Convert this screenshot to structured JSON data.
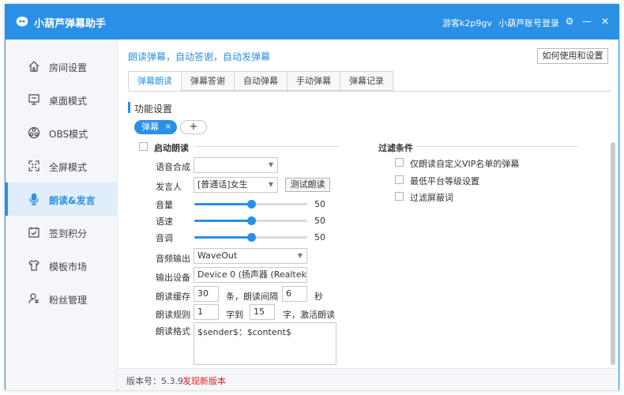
{
  "window": {
    "title": "小葫芦弹幕助手",
    "guest": "游客k2p9gv",
    "login": "小葫芦账号登录"
  },
  "sidebar": {
    "items": [
      {
        "label": "房间设置",
        "icon": "home-icon",
        "active": false
      },
      {
        "label": "桌面模式",
        "icon": "monitor-icon",
        "active": false
      },
      {
        "label": "OBS模式",
        "icon": "obs-icon",
        "active": false
      },
      {
        "label": "全屏模式",
        "icon": "fullscreen-icon",
        "active": false
      },
      {
        "label": "朗读&发言",
        "icon": "microphone-icon",
        "active": true
      },
      {
        "label": "签到积分",
        "icon": "calendar-check-icon",
        "active": false
      },
      {
        "label": "模板市场",
        "icon": "shirt-icon",
        "active": false
      },
      {
        "label": "粉丝管理",
        "icon": "fans-icon",
        "active": false
      }
    ]
  },
  "main": {
    "headline": "朗读弹幕，自动答谢，自动发弹幕",
    "help_button": "如何使用和设置",
    "tabs": [
      "弹幕朗读",
      "弹幕答谢",
      "自动弹幕",
      "手动弹幕",
      "弹幕记录"
    ],
    "active_tab": 0,
    "section_title": "功能设置",
    "chip": {
      "label": "弹幕",
      "close": "×"
    },
    "add_chip": "+",
    "enable_reading": "启动朗读",
    "voice_synth": {
      "label": "语音合成",
      "value": ""
    },
    "speaker": {
      "label": "发言人",
      "value": "[普通话]女生",
      "test_button": "测试朗读"
    },
    "sliders": [
      {
        "label": "音量",
        "value": 50,
        "max": 100
      },
      {
        "label": "语速",
        "value": 50,
        "max": 100
      },
      {
        "label": "音调",
        "value": 50,
        "max": 100
      }
    ],
    "audio_output": {
      "label": "音频输出",
      "value": "WaveOut"
    },
    "output_device": {
      "label": "输出设备",
      "value": "Device 0 (扬声器 (Realtek(R)"
    },
    "cache": {
      "label": "朗读缓存",
      "value": "30",
      "unit": "条，朗读间隔",
      "interval": "6",
      "interval_unit": "秒"
    },
    "rule": {
      "label": "朗读规则",
      "from": "1",
      "to_label": "字到",
      "to": "15",
      "suffix": "字，激活朗读"
    },
    "format": {
      "label": "朗读格式",
      "value": "$sender$：$content$"
    },
    "filter": {
      "title": "过滤条件",
      "options": [
        "仅朗读自定义VIP名单的弹幕",
        "最低平台等级设置",
        "过滤屏蔽词"
      ]
    },
    "footer": {
      "version_label": "版本号：5.3.9",
      "new_version": "发现新版本"
    }
  },
  "colors": {
    "accent": "#2a90e6",
    "alert": "#e02020"
  }
}
